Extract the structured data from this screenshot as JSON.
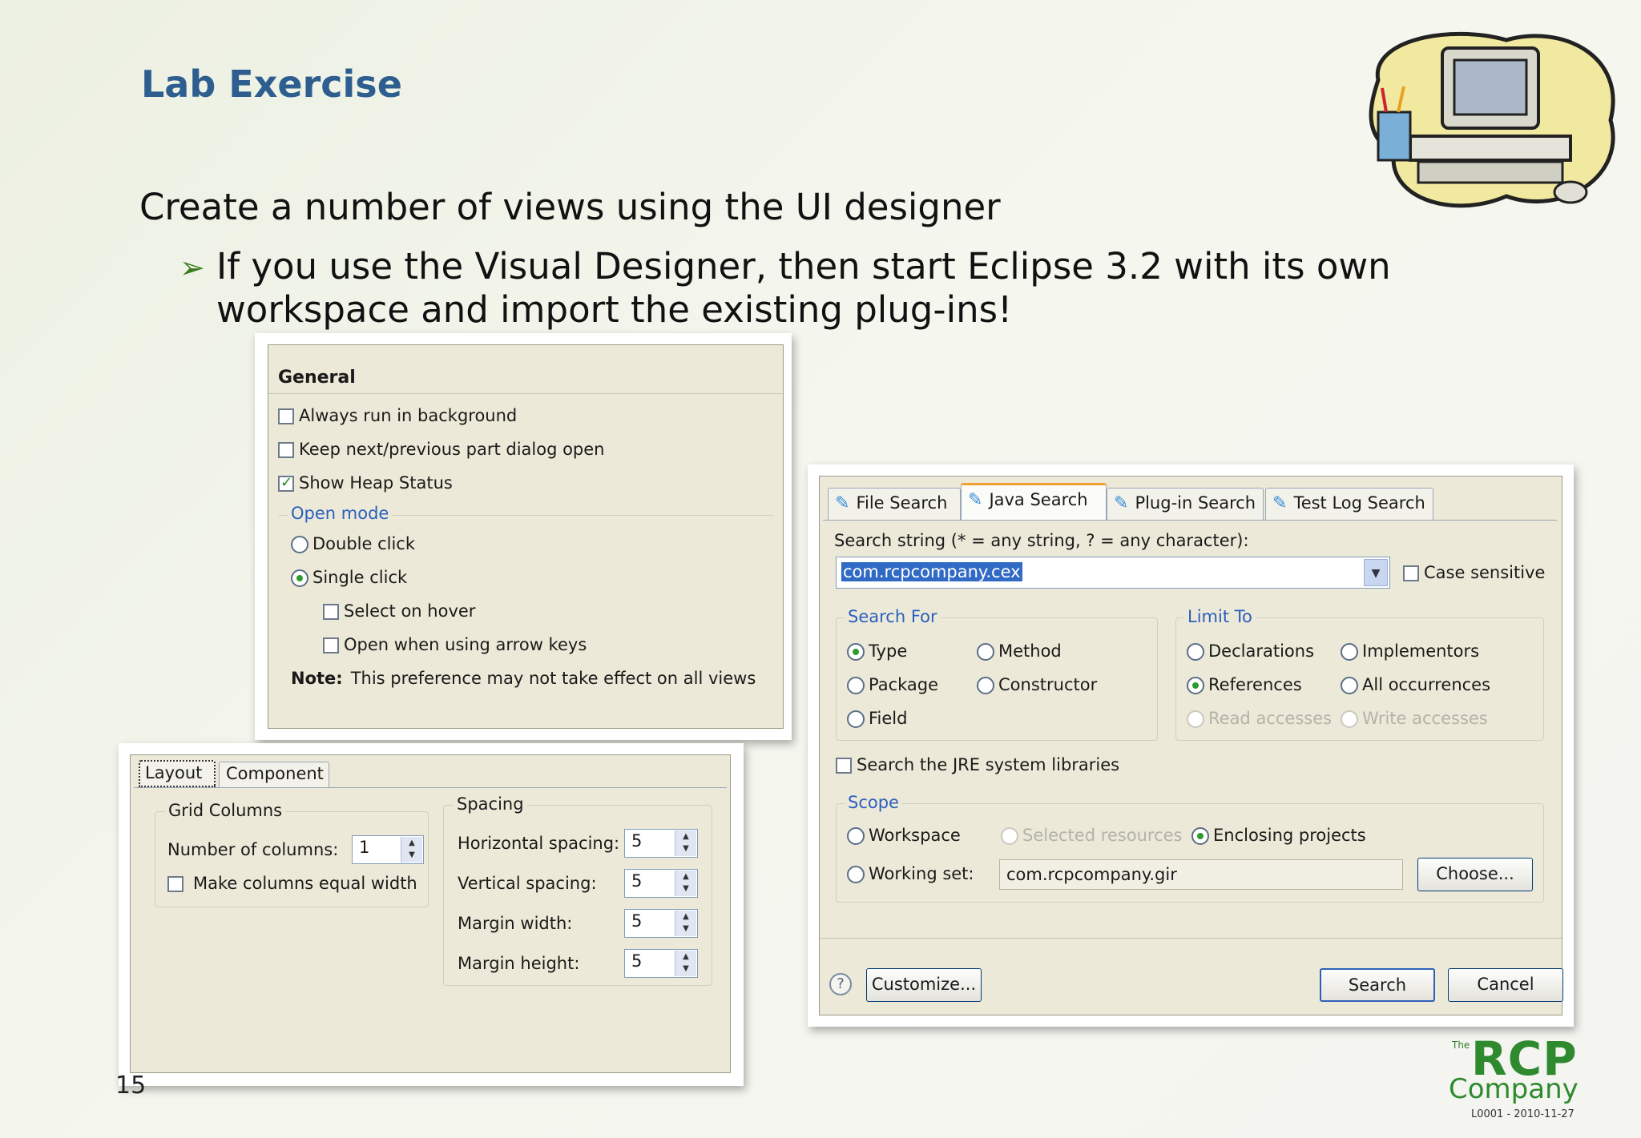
{
  "slide": {
    "title": "Lab Exercise",
    "bullet1": "Create a number of views using the UI designer",
    "bullet2": "If you use the Visual Designer, then start Eclipse 3.2 with its own workspace and import the existing plug-ins!",
    "page_number": "15"
  },
  "general_dialog": {
    "header": "General",
    "always_background": "Always run in background",
    "keep_next_previous": "Keep next/previous part dialog open",
    "show_heap": "Show Heap Status",
    "open_mode_label": "Open mode",
    "double_click": "Double click",
    "single_click": "Single click",
    "select_on_hover": "Select on hover",
    "open_arrow_keys": "Open when using arrow keys",
    "note_label": "Note:",
    "note_text": "This preference may not take effect on all views",
    "states": {
      "always_background": false,
      "keep_next_previous": false,
      "show_heap": true,
      "open_mode": "single",
      "select_on_hover": false,
      "open_arrow_keys": false
    }
  },
  "layout_dialog": {
    "tabs": [
      "Layout",
      "Component"
    ],
    "grid_columns_label": "Grid Columns",
    "number_of_columns_label": "Number of columns:",
    "number_of_columns_value": "1",
    "equal_width_label": "Make columns equal width",
    "spacing_label": "Spacing",
    "horizontal_spacing_label": "Horizontal spacing:",
    "horizontal_spacing_value": "5",
    "vertical_spacing_label": "Vertical spacing:",
    "vertical_spacing_value": "5",
    "margin_width_label": "Margin width:",
    "margin_width_value": "5",
    "margin_height_label": "Margin height:",
    "margin_height_value": "5"
  },
  "search_dialog": {
    "tabs": [
      "File Search",
      "Java Search",
      "Plug-in Search",
      "Test Log Search"
    ],
    "active_tab": "Java Search",
    "search_string_label": "Search string (* = any string, ? = any character):",
    "search_string_value": "com.rcpcompany.cex",
    "case_sensitive_label": "Case sensitive",
    "search_for_label": "Search For",
    "type_label": "Type",
    "method_label": "Method",
    "package_label": "Package",
    "constructor_label": "Constructor",
    "field_label": "Field",
    "limit_to_label": "Limit To",
    "declarations_label": "Declarations",
    "implementors_label": "Implementors",
    "references_label": "References",
    "all_occurrences_label": "All occurrences",
    "read_accesses_label": "Read accesses",
    "write_accesses_label": "Write accesses",
    "jre_label": "Search the JRE system libraries",
    "scope_label": "Scope",
    "workspace_label": "Workspace",
    "selected_resources_label": "Selected resources",
    "enclosing_projects_label": "Enclosing projects",
    "working_set_label": "Working set:",
    "working_set_value": "com.rcpcompany.gir",
    "choose_button": "Choose...",
    "help_icon_text": "?",
    "customize_button": "Customize...",
    "search_button": "Search",
    "cancel_button": "Cancel"
  },
  "logo": {
    "the": "The",
    "rcp": "RCP",
    "company": "Company",
    "ref": "L0001 - 2010-11-27"
  },
  "colors": {
    "title": "#2d5e8f",
    "xp_panel": "#ece9d8",
    "group_label": "#2b5fbf",
    "logo_green": "#2f8a2f"
  }
}
